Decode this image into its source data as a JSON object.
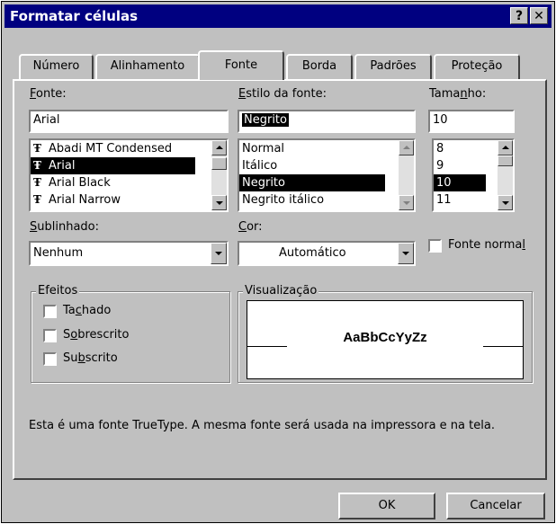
{
  "window": {
    "title": "Formatar células",
    "help_label": "?",
    "close_label": "✕"
  },
  "tabs": [
    {
      "label": "Número"
    },
    {
      "label": "Alinhamento"
    },
    {
      "label": "Fonte"
    },
    {
      "label": "Borda"
    },
    {
      "label": "Padrões"
    },
    {
      "label": "Proteção"
    }
  ],
  "font": {
    "label_u": "F",
    "label_rest": "onte:",
    "value": "Arial",
    "list": [
      "Abadi MT Condensed",
      "Arial",
      "Arial Black",
      "Arial Narrow"
    ],
    "truetype_icon": "truetype-icon"
  },
  "style": {
    "label_u": "E",
    "label_rest": "stilo da fonte:",
    "value": "Negrito",
    "list": [
      "Normal",
      "Itálico",
      "Negrito",
      "Negrito itálico"
    ]
  },
  "size": {
    "label_pre": "Tama",
    "label_u": "n",
    "label_rest": "ho:",
    "value": "10",
    "list": [
      "8",
      "9",
      "10",
      "11"
    ]
  },
  "underline": {
    "label_u": "S",
    "label_rest": "ublinhado:",
    "value": "Nenhum"
  },
  "color": {
    "label_u": "C",
    "label_rest": "or:",
    "value": "Automático"
  },
  "normal_font": {
    "label_pre": "Fonte norma",
    "label_u": "l"
  },
  "effects": {
    "title": "Efeitos",
    "items": [
      {
        "pre": "Ta",
        "u": "c",
        "post": "hado"
      },
      {
        "pre": "S",
        "u": "o",
        "post": "brescrito"
      },
      {
        "pre": "Su",
        "u": "b",
        "post": "scrito"
      }
    ]
  },
  "preview": {
    "title": "Visualização",
    "sample": "AaBbCcYyZz"
  },
  "description": "Esta é uma fonte TrueType. A mesma fonte será usada na impressora e na tela.",
  "buttons": {
    "ok": "OK",
    "cancel": "Cancelar"
  }
}
